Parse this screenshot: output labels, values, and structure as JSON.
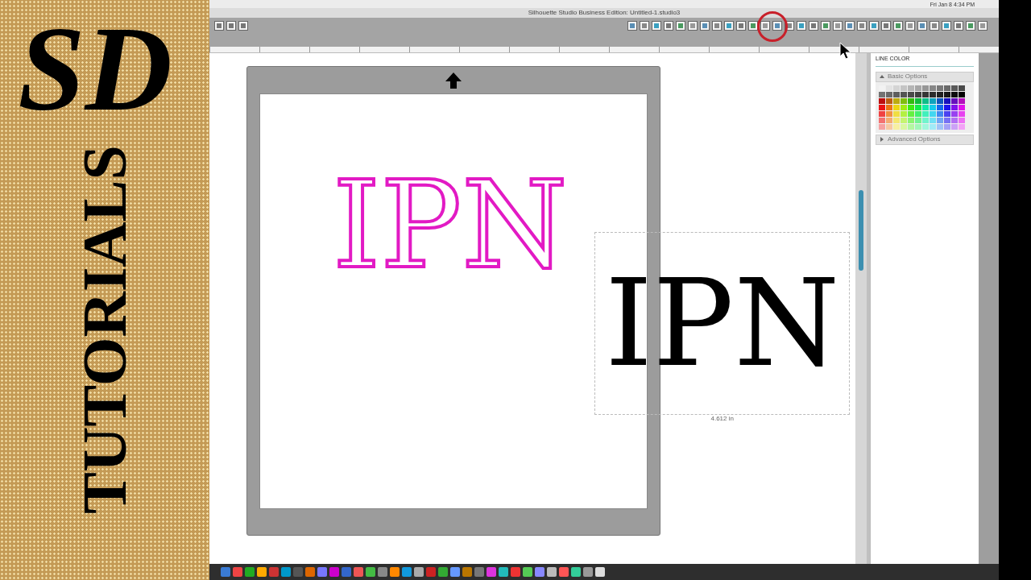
{
  "menu_bar": {
    "clock": "Fri Jan 8  4:34 PM"
  },
  "window": {
    "title": "Silhouette Studio Business Edition: Untitled-1.studio3"
  },
  "banner": {
    "logo": "SD",
    "title": "TUTORIALS"
  },
  "canvas": {
    "monograms": [
      {
        "text": "IPN",
        "kind": "outline",
        "selected": false
      },
      {
        "text": "IPN",
        "kind": "solid",
        "selected": true
      }
    ],
    "dimension": "4.612 in"
  },
  "panel": {
    "title": "LINE COLOR",
    "sections": [
      {
        "label": "Basic Options",
        "expanded": true
      },
      {
        "label": "Advanced Options",
        "expanded": false
      }
    ]
  }
}
